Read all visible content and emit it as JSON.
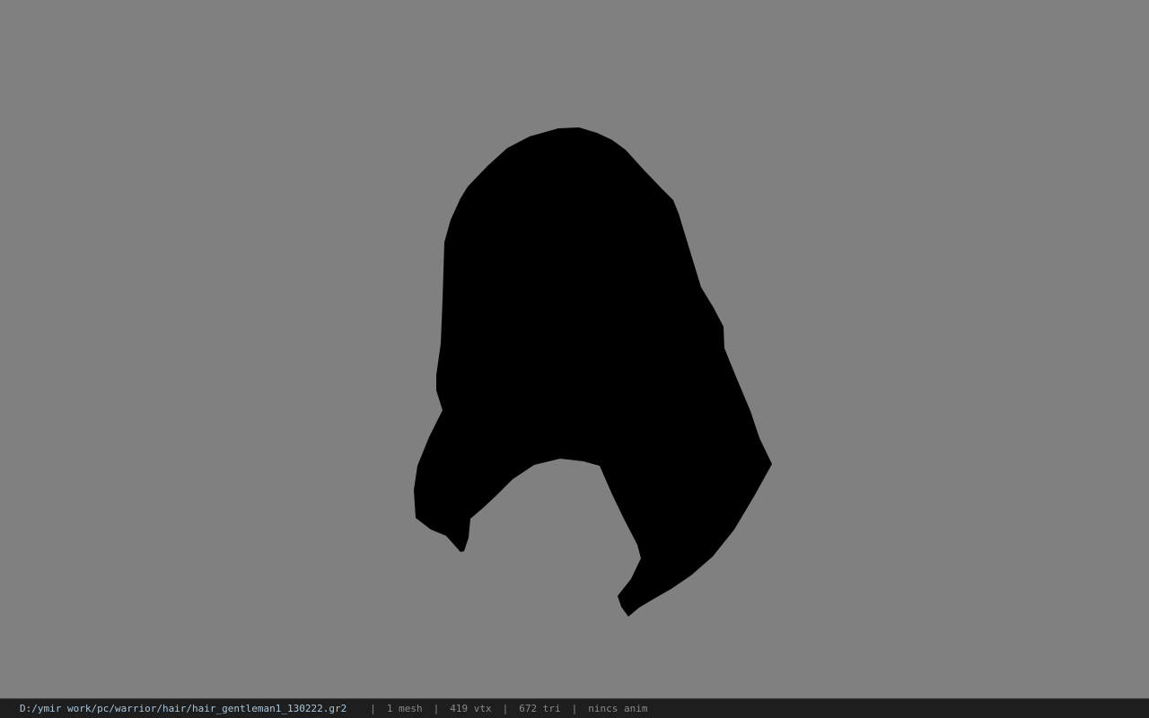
{
  "viewport": {
    "background_color": "#808080",
    "mesh_color": "#000000"
  },
  "status_bar": {
    "file_path": "D:/ymir work/pc/warrior/hair/hair_gentleman1_130222.gr2",
    "separator": "|",
    "mesh_count": "1 mesh",
    "vertex_count": "419 vtx",
    "triangle_count": "672 tri",
    "animation_status": "nincs anim"
  }
}
